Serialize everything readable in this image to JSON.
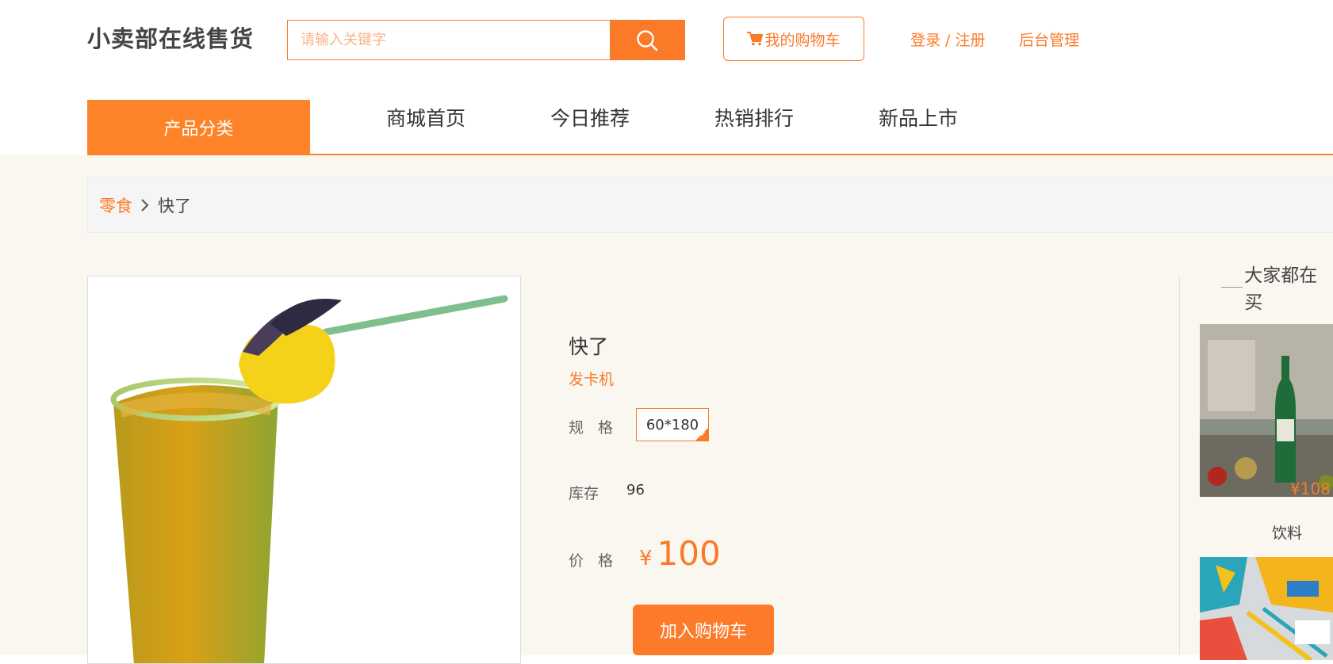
{
  "header": {
    "logo": "小卖部在线售货",
    "search_placeholder": "请输入关键字",
    "cart_label": "我的购物车",
    "login_label": "登录 / 注册",
    "admin_label": "后台管理"
  },
  "nav": {
    "category_label": "产品分类",
    "items": [
      "商城首页",
      "今日推荐",
      "热销排行",
      "新品上市"
    ]
  },
  "breadcrumb": {
    "category": "零食",
    "current": "快了"
  },
  "product": {
    "name": "快了",
    "subtitle": "发卡机",
    "spec_label": "规 格",
    "spec_value": "60*180",
    "stock_label": "库存",
    "stock_value": "96",
    "price_label": "价 格",
    "currency": "¥",
    "price": "100",
    "add_to_cart": "加入购物车"
  },
  "sidebar": {
    "title": "大家都在买",
    "items": [
      {
        "price": "¥108",
        "caption": "饮料"
      }
    ]
  },
  "colors": {
    "accent": "#fb7a27",
    "page_bg": "#f9f7f0"
  },
  "icons": {
    "search": "search-icon",
    "cart": "cart-icon",
    "breadcrumb_sep": "chevron-right-icon"
  }
}
